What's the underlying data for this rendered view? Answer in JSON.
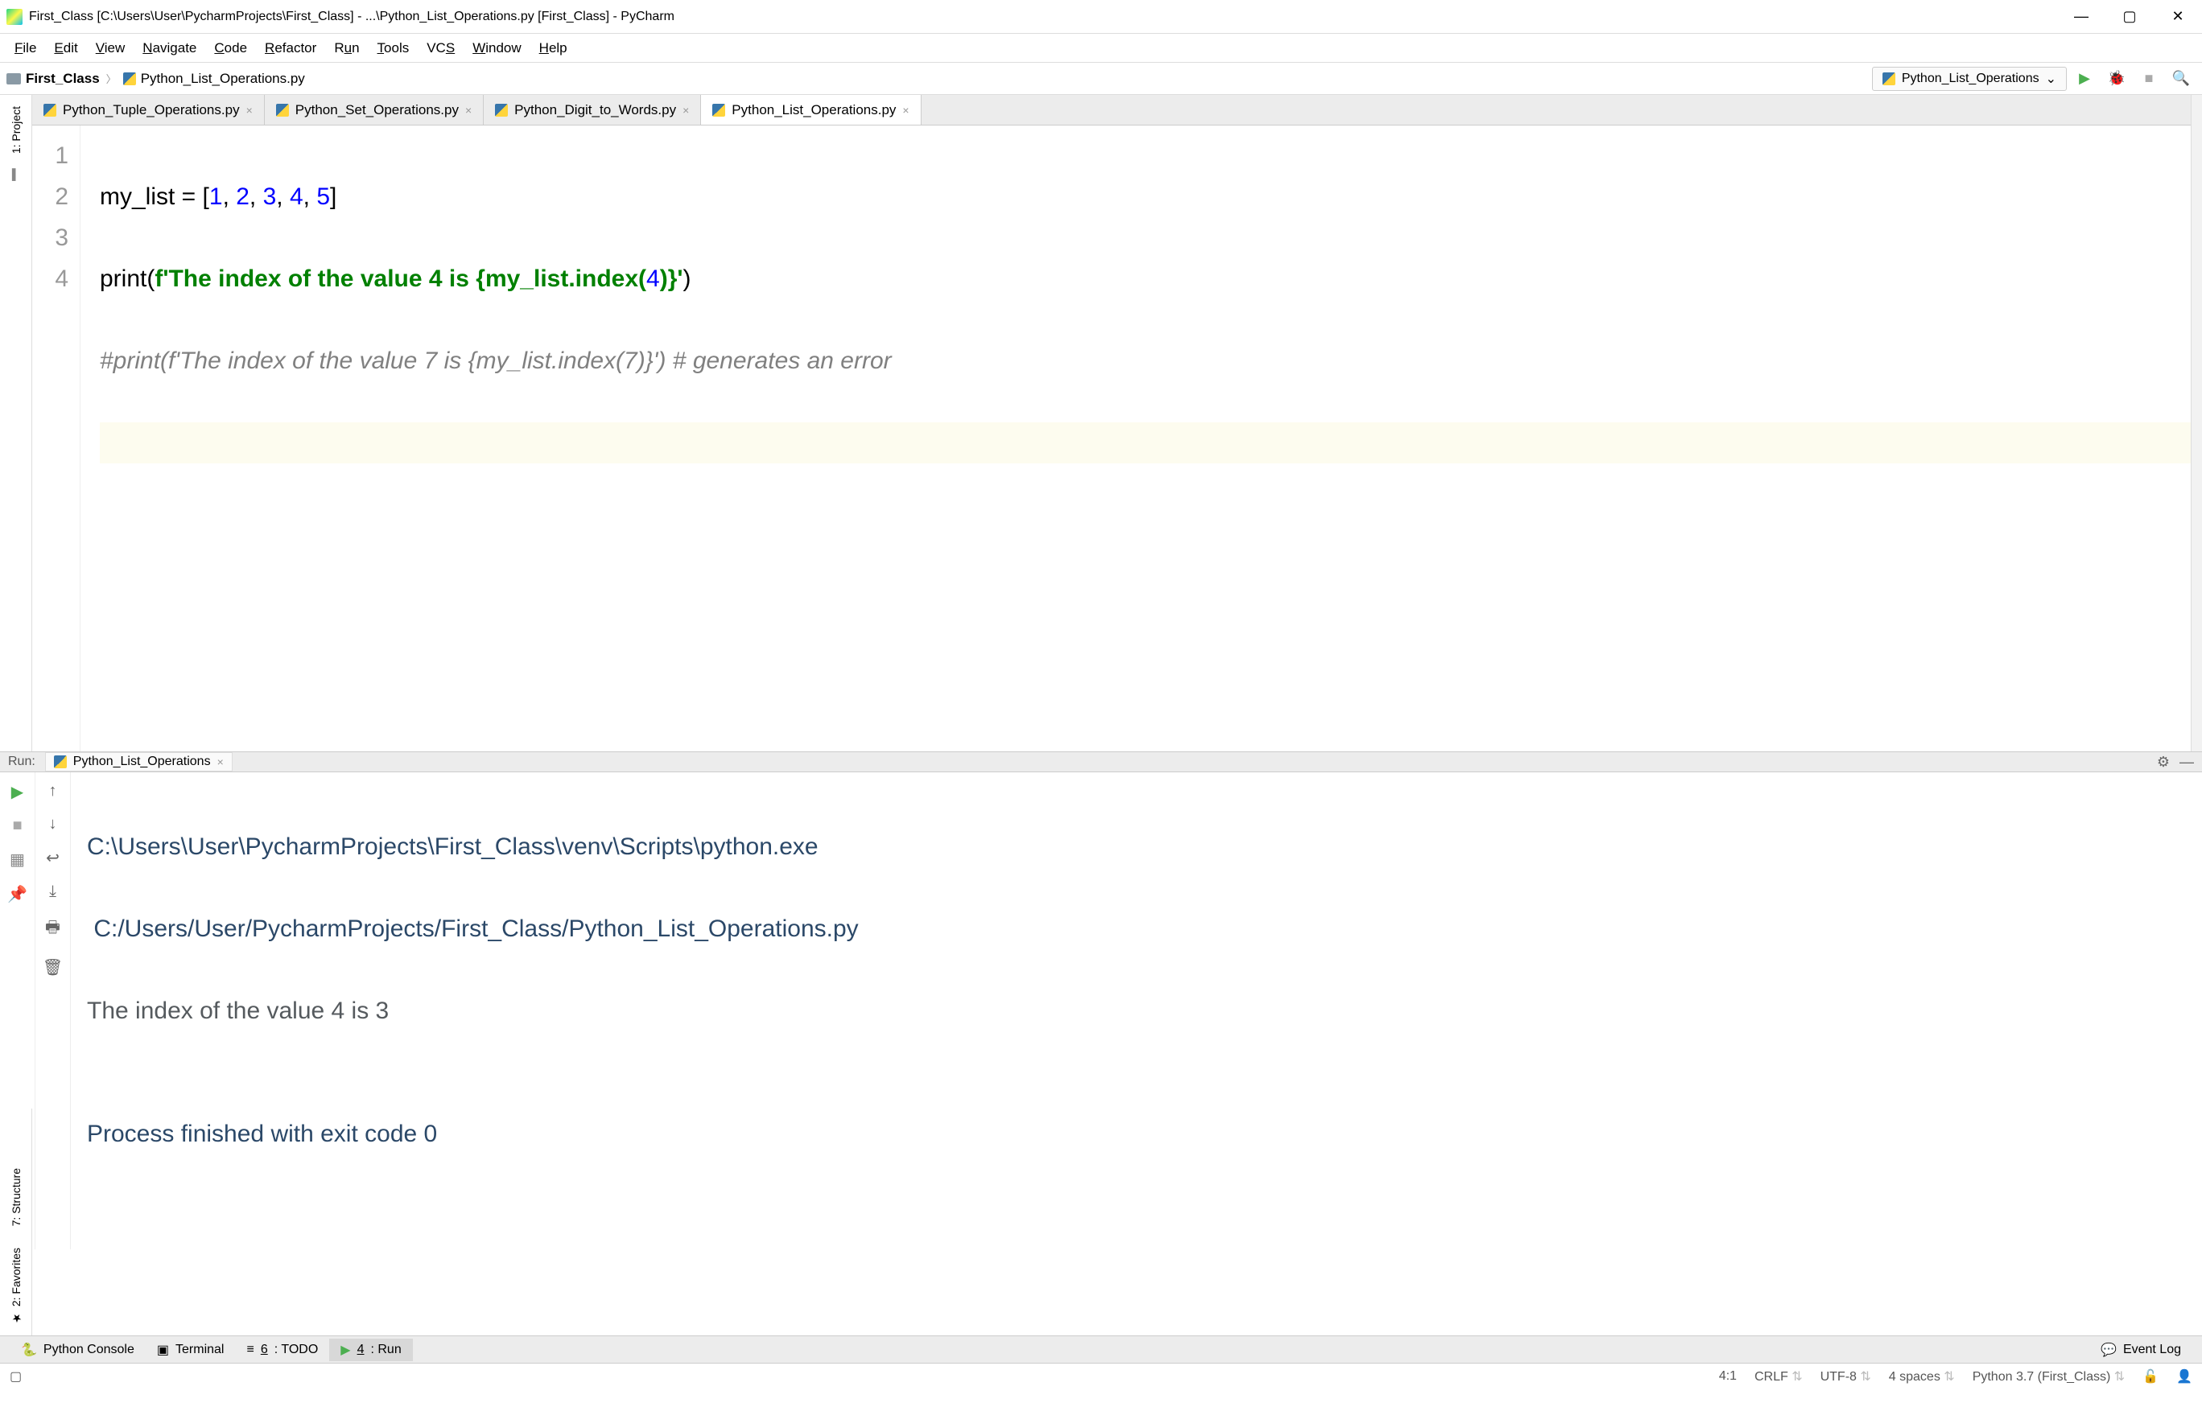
{
  "titlebar": {
    "text": "First_Class [C:\\Users\\User\\PycharmProjects\\First_Class] - ...\\Python_List_Operations.py [First_Class] - PyCharm"
  },
  "menubar": [
    "File",
    "Edit",
    "View",
    "Navigate",
    "Code",
    "Refactor",
    "Run",
    "Tools",
    "VCS",
    "Window",
    "Help"
  ],
  "breadcrumb": {
    "project": "First_Class",
    "file": "Python_List_Operations.py"
  },
  "run_config": {
    "name": "Python_List_Operations"
  },
  "tabs": [
    {
      "label": "Python_Tuple_Operations.py",
      "active": false
    },
    {
      "label": "Python_Set_Operations.py",
      "active": false
    },
    {
      "label": "Python_Digit_to_Words.py",
      "active": false
    },
    {
      "label": "Python_List_Operations.py",
      "active": true
    }
  ],
  "code_lines": [
    "1",
    "2",
    "3",
    "4"
  ],
  "code": {
    "l1": {
      "a": "my_list = [",
      "n1": "1",
      "c1": ", ",
      "n2": "2",
      "c2": ", ",
      "n3": "3",
      "c3": ", ",
      "n4": "4",
      "c4": ", ",
      "n5": "5",
      "b": "]"
    },
    "l2": {
      "a": "print(",
      "f": "f'",
      "s": "The index of the value 4 is ",
      "lb": "{my_list.index(",
      "n": "4",
      "rb": ")}",
      "eq": "'",
      "cp": ")"
    },
    "l3": "#print(f'The index of the value 7 is {my_list.index(7)}') # generates an error"
  },
  "side_tabs": {
    "project": "1: Project",
    "structure": "7: Structure",
    "favorites": "2: Favorites"
  },
  "run_panel": {
    "label": "Run:",
    "tab": "Python_List_Operations",
    "line1": "C:\\Users\\User\\PycharmProjects\\First_Class\\venv\\Scripts\\python.exe",
    "line2": " C:/Users/User/PycharmProjects/First_Class/Python_List_Operations.py",
    "line3": "The index of the value 4 is 3",
    "line4": "",
    "line5": "Process finished with exit code 0"
  },
  "bottom_tabs": {
    "console": "Python Console",
    "terminal": "Terminal",
    "todo_pre": "6",
    "todo_post": ": TODO",
    "run_pre": "4",
    "run_post": ": Run",
    "event_log": "Event Log"
  },
  "status": {
    "pos": "4:1",
    "line_sep": "CRLF",
    "enc": "UTF-8",
    "indent": "4 spaces",
    "interp": "Python 3.7 (First_Class)"
  }
}
